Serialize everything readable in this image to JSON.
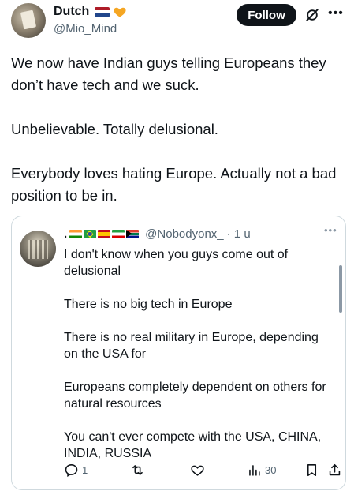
{
  "author": {
    "display_name": "Dutch",
    "handle": "@Mio_Mind",
    "follow_label": "Follow"
  },
  "tweet": {
    "paragraphs": [
      "We now have Indian guys telling Europeans they don’t have tech and we suck.",
      "Unbelievable. Totally delusional.",
      "Everybody loves hating Europe. Actually not a bad position to be in."
    ]
  },
  "quote": {
    "handle": "@Nobodyonx_",
    "time": "· 1 u",
    "paragraphs": [
      "I don't know when you guys come out of delusional",
      "There is no big tech in Europe",
      "There is no real military in Europe, depending on the USA for",
      "Europeans completely dependent on others for natural resources",
      "You can't ever compete with the USA, CHINA, INDIA, RUSSIA"
    ],
    "replies": "1",
    "views": "30"
  },
  "colors": {
    "accent": "#0f1419",
    "muted": "#536471",
    "border": "#cfd9de",
    "heart": "#f5a623"
  },
  "icons": {
    "heart": "orange-heart-icon",
    "grok": "grok-icon",
    "reply": "reply-icon",
    "retweet": "retweet-icon",
    "like": "like-icon",
    "views": "views-icon",
    "bookmark": "bookmark-icon",
    "share": "share-icon"
  }
}
